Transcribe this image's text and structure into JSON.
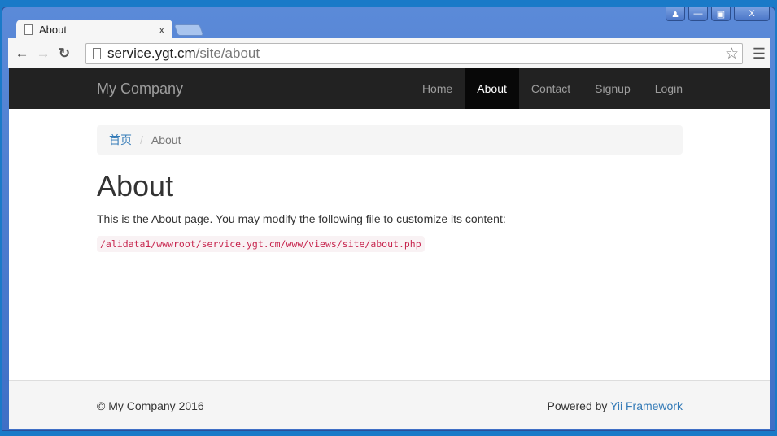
{
  "browser": {
    "tab_title": "About",
    "tab_close": "x",
    "url_host": "service.ygt.cm",
    "url_path": "/site/about",
    "window_buttons": [
      "user",
      "minimize",
      "maximize",
      "close"
    ]
  },
  "navbar": {
    "brand": "My Company",
    "links": [
      {
        "label": "Home"
      },
      {
        "label": "About",
        "active": true
      },
      {
        "label": "Contact"
      },
      {
        "label": "Signup"
      },
      {
        "label": "Login"
      }
    ]
  },
  "breadcrumb": {
    "home": "首页",
    "separator": "/",
    "current": "About"
  },
  "main": {
    "title": "About",
    "intro": "This is the About page. You may modify the following file to customize its content:",
    "file_path": "/alidata1/wwwroot/service.ygt.cm/www/views/site/about.php"
  },
  "footer": {
    "copyright": "© My Company 2016",
    "powered_prefix": "Powered by",
    "powered_link": "Yii Framework"
  }
}
